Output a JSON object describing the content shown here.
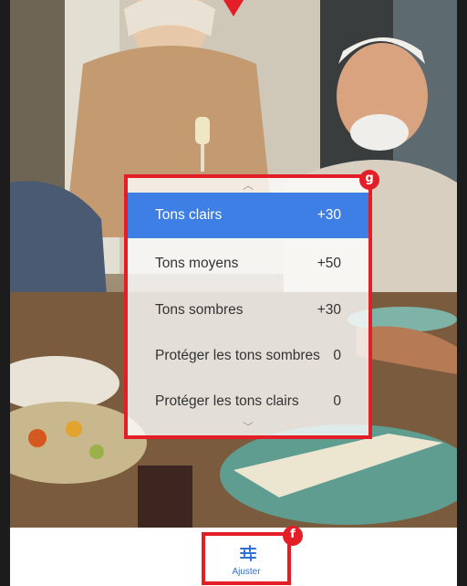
{
  "tone_menu": {
    "items": [
      {
        "label": "Tons clairs",
        "value": "+30",
        "selected": true
      },
      {
        "label": "Tons moyens",
        "value": "+50",
        "selected": false
      },
      {
        "label": "Tons sombres",
        "value": "+30",
        "selected": false
      },
      {
        "label": "Protéger les tons sombres",
        "value": "0",
        "selected": false
      },
      {
        "label": "Protéger les tons clairs",
        "value": "0",
        "selected": false
      }
    ],
    "badge": "g"
  },
  "toolbar": {
    "adjust_label": "Ajuster",
    "adjust_icon": "sliders-icon",
    "badge": "f"
  },
  "colors": {
    "accent_blue": "#3e7fe6",
    "callout_red": "#e41e26"
  }
}
